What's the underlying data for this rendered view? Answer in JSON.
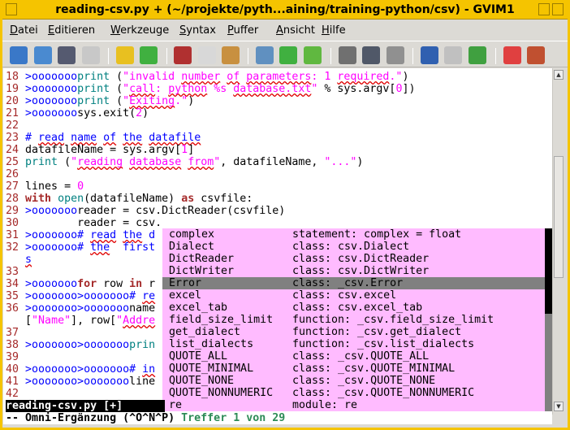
{
  "window": {
    "title": "reading-csv.py + (~/projekte/pyth...aining/training-python/csv) - GVIM1"
  },
  "menu": [
    {
      "key": "D",
      "rest": "atei"
    },
    {
      "key": "E",
      "rest": "ditieren"
    },
    {
      "key": "W",
      "rest": "erkzeuge"
    },
    {
      "key": "S",
      "rest": "yntax"
    },
    {
      "key": "P",
      "rest": "uffer"
    },
    {
      "key": "A",
      "rest": "nsicht"
    },
    {
      "key": "H",
      "rest": "ilfe"
    }
  ],
  "toolbar": [
    "open-icon",
    "save-load-icon",
    "save-icon",
    "print-icon",
    "undo-icon",
    "redo-icon",
    "cut-icon",
    "copy-icon",
    "paste-icon",
    "find-replace-icon",
    "forward-icon",
    "back-icon",
    "load-session-icon",
    "save-session-icon",
    "run-script-icon",
    "make-icon",
    "table-icon",
    "jump-icon",
    "help-icon",
    "find-help-icon"
  ],
  "colors": {
    "popup_bg": "#ffbbff",
    "popup_sel": "#808080",
    "line_number": "#a52a2a",
    "string": "#ff00ff",
    "comment": "#0000ff",
    "title_bar": "#f5c400"
  },
  "lines": [
    [
      [
        "18 ",
        "ln"
      ],
      [
        ">ooooooo",
        "sk"
      ],
      [
        "print",
        "pr"
      ],
      [
        " (",
        "tx"
      ],
      [
        "\"invalid ",
        "st"
      ],
      [
        "number",
        "st sp"
      ],
      [
        " ",
        "st"
      ],
      [
        "of",
        "st sp"
      ],
      [
        " ",
        "st"
      ],
      [
        "parameters",
        "st sp"
      ],
      [
        ": 1 ",
        "st"
      ],
      [
        "required",
        "st sp"
      ],
      [
        ".\"",
        "st"
      ],
      [
        ")",
        "tx"
      ]
    ],
    [
      [
        "19 ",
        "ln"
      ],
      [
        ">ooooooo",
        "sk"
      ],
      [
        "print",
        "pr"
      ],
      [
        " (",
        "tx"
      ],
      [
        "\"",
        "st"
      ],
      [
        "call",
        "st sp"
      ],
      [
        ": ",
        "st"
      ],
      [
        "python",
        "st sp"
      ],
      [
        " %s ",
        "st"
      ],
      [
        "database.txt",
        "st sp"
      ],
      [
        "\"",
        "st"
      ],
      [
        " % sys.argv[",
        "tx"
      ],
      [
        "0",
        "nm"
      ],
      [
        "])",
        "tx"
      ]
    ],
    [
      [
        "20 ",
        "ln"
      ],
      [
        ">ooooooo",
        "sk"
      ],
      [
        "print",
        "pr"
      ],
      [
        " (",
        "tx"
      ],
      [
        "\"",
        "st"
      ],
      [
        "Exiting",
        "st sp"
      ],
      [
        ".\"",
        "st"
      ],
      [
        ")",
        "tx"
      ]
    ],
    [
      [
        "21 ",
        "ln"
      ],
      [
        ">ooooooo",
        "sk"
      ],
      [
        "sys.exit(",
        "tx"
      ],
      [
        "2",
        "nm"
      ],
      [
        ")",
        "tx"
      ]
    ],
    [
      [
        "22 ",
        "ln"
      ]
    ],
    [
      [
        "23 ",
        "ln"
      ],
      [
        "# ",
        "cm"
      ],
      [
        "read",
        "cm sp"
      ],
      [
        " ",
        "cm"
      ],
      [
        "name",
        "cm sp"
      ],
      [
        " ",
        "cm"
      ],
      [
        "of",
        "cm sp"
      ],
      [
        " ",
        "cm"
      ],
      [
        "the",
        "cm sp"
      ],
      [
        " ",
        "cm"
      ],
      [
        "datafile",
        "cm sp"
      ]
    ],
    [
      [
        "24 ",
        "ln"
      ],
      [
        "datafileName = sys.argv[",
        "tx"
      ],
      [
        "1",
        "nm"
      ],
      [
        "]",
        "tx"
      ]
    ],
    [
      [
        "25 ",
        "ln"
      ],
      [
        "print",
        "pr"
      ],
      [
        " (",
        "tx"
      ],
      [
        "\"",
        "st"
      ],
      [
        "reading",
        "st sp"
      ],
      [
        " ",
        "st"
      ],
      [
        "database",
        "st sp"
      ],
      [
        " ",
        "st"
      ],
      [
        "from",
        "st sp"
      ],
      [
        "\"",
        "st"
      ],
      [
        ", datafileName, ",
        "tx"
      ],
      [
        "\"...\"",
        "st"
      ],
      [
        ")",
        "tx"
      ]
    ],
    [
      [
        "26 ",
        "ln"
      ]
    ],
    [
      [
        "27 ",
        "ln"
      ],
      [
        "lines = ",
        "tx"
      ],
      [
        "0",
        "nm"
      ]
    ],
    [
      [
        "28 ",
        "ln"
      ],
      [
        "with",
        "kw"
      ],
      [
        " ",
        "tx"
      ],
      [
        "open",
        "pr"
      ],
      [
        "(datafileName) ",
        "tx"
      ],
      [
        "as",
        "kw"
      ],
      [
        " csvfile:",
        "tx"
      ]
    ],
    [
      [
        "29 ",
        "ln"
      ],
      [
        ">ooooooo",
        "sk"
      ],
      [
        "reader = csv.DictReader(csvfile)",
        "tx"
      ]
    ],
    [
      [
        "30 ",
        "ln"
      ],
      [
        "        reader = csv.",
        "tx"
      ]
    ],
    [
      [
        "31 ",
        "ln"
      ],
      [
        ">ooooooo",
        "sk"
      ],
      [
        "# ",
        "cm"
      ],
      [
        "read",
        "cm sp"
      ],
      [
        " ",
        "cm"
      ],
      [
        "the",
        "cm sp"
      ],
      [
        " d",
        "cm"
      ]
    ],
    [
      [
        "32 ",
        "ln"
      ],
      [
        ">ooooooo",
        "sk"
      ],
      [
        "# ",
        "cm"
      ],
      [
        "the",
        "cm sp"
      ],
      [
        "  first",
        "cm"
      ]
    ],
    [
      [
        "   ",
        "ln"
      ],
      [
        "s",
        "cm sp"
      ]
    ],
    [
      [
        "33 ",
        "ln"
      ]
    ],
    [
      [
        "34 ",
        "ln"
      ],
      [
        ">ooooooo",
        "sk"
      ],
      [
        "for",
        "kw"
      ],
      [
        " row ",
        "tx"
      ],
      [
        "in",
        "kw"
      ],
      [
        " r",
        "tx"
      ]
    ],
    [
      [
        "35 ",
        "ln"
      ],
      [
        ">ooooooo>ooooooo",
        "sk"
      ],
      [
        "# ",
        "cm"
      ],
      [
        "re",
        "cm sp"
      ]
    ],
    [
      [
        "36 ",
        "ln"
      ],
      [
        ">ooooooo>ooooooo",
        "sk"
      ],
      [
        "name",
        "tx"
      ]
    ],
    [
      [
        "   ",
        "ln"
      ],
      [
        "[",
        "tx"
      ],
      [
        "\"Name\"",
        "st"
      ],
      [
        "], row[",
        "tx"
      ],
      [
        "\"",
        "st"
      ],
      [
        "Addre",
        "st sp"
      ]
    ],
    [
      [
        "37 ",
        "ln"
      ]
    ],
    [
      [
        "38 ",
        "ln"
      ],
      [
        ">ooooooo>ooooooo",
        "sk"
      ],
      [
        "prin",
        "pr"
      ]
    ],
    [
      [
        "39 ",
        "ln"
      ]
    ],
    [
      [
        "40 ",
        "ln"
      ],
      [
        ">ooooooo>ooooooo",
        "sk"
      ],
      [
        "# ",
        "cm"
      ],
      [
        "in",
        "cm sp"
      ]
    ],
    [
      [
        "41 ",
        "ln"
      ],
      [
        ">ooooooo>ooooooo",
        "sk"
      ],
      [
        "line",
        "tx"
      ]
    ],
    [
      [
        "42 ",
        "ln"
      ]
    ]
  ],
  "statusline": "reading-csv.py [+]",
  "cmdline": {
    "mode": "-- Omni-Ergänzung (^O^N^P)",
    "match": "Treffer 1 von 29"
  },
  "popup": {
    "selected": 4,
    "items": [
      {
        "word": "complex",
        "kind": "statement: complex = float"
      },
      {
        "word": "Dialect",
        "kind": "class: csv.Dialect"
      },
      {
        "word": "DictReader",
        "kind": "class: csv.DictReader"
      },
      {
        "word": "DictWriter",
        "kind": "class: csv.DictWriter"
      },
      {
        "word": "Error",
        "kind": "class: _csv.Error"
      },
      {
        "word": "excel",
        "kind": "class: csv.excel"
      },
      {
        "word": "excel_tab",
        "kind": "class: csv.excel_tab"
      },
      {
        "word": "field_size_limit",
        "kind": "function: _csv.field_size_limit"
      },
      {
        "word": "get_dialect",
        "kind": "function: _csv.get_dialect"
      },
      {
        "word": "list_dialects",
        "kind": "function: _csv.list_dialects"
      },
      {
        "word": "QUOTE_ALL",
        "kind": "class: _csv.QUOTE_ALL"
      },
      {
        "word": "QUOTE_MINIMAL",
        "kind": "class: _csv.QUOTE_MINIMAL"
      },
      {
        "word": "QUOTE_NONE",
        "kind": "class: _csv.QUOTE_NONE"
      },
      {
        "word": "QUOTE_NONNUMERIC",
        "kind": "class: _csv.QUOTE_NONNUMERIC"
      },
      {
        "word": "re",
        "kind": "module: re"
      }
    ]
  }
}
